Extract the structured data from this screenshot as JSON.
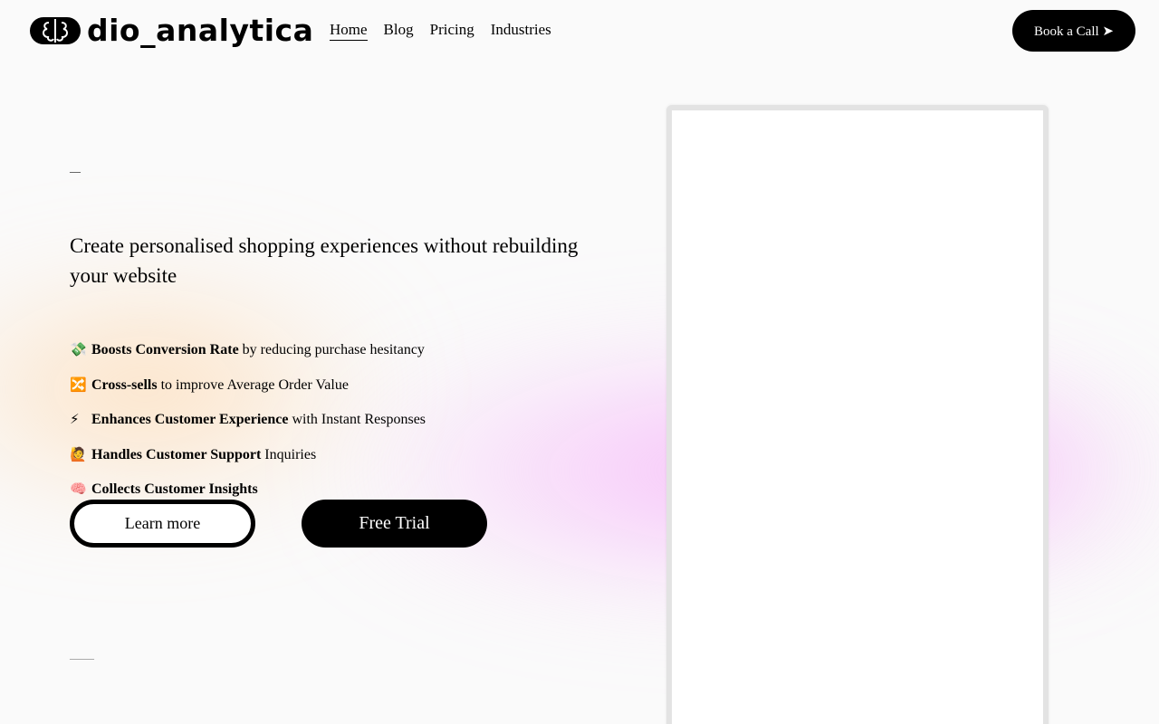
{
  "brand": {
    "name": "dio_analytica"
  },
  "nav": {
    "items": [
      {
        "label": "Home",
        "active": true
      },
      {
        "label": "Blog"
      },
      {
        "label": "Pricing"
      },
      {
        "label": "Industries"
      }
    ]
  },
  "header": {
    "cta_label": "Book a Call ➤"
  },
  "hero": {
    "eyebrow": "—",
    "headline": "Create personalised shopping experiences without rebuilding your website",
    "features": [
      {
        "icon": "💸",
        "bold": "Boosts Conversion Rate",
        "rest": " by reducing purchase hesitancy"
      },
      {
        "icon": "🔀",
        "bold": "Cross-sells",
        "rest": " to improve Average Order Value"
      },
      {
        "icon": "⚡",
        "bold": "Enhances Customer Experience",
        "rest": " with Instant Responses"
      },
      {
        "icon": "🙋",
        "bold": "Handles Customer Support",
        "rest": " Inquiries"
      },
      {
        "icon": "🧠",
        "bold": "Collects Customer Insights",
        "rest": ""
      }
    ],
    "learn_more_label": "Learn more",
    "free_trial_label": "Free Trial",
    "footer_dash": "———"
  },
  "colors": {
    "accent": "#000000",
    "background": "#fafafa",
    "glow_pink": "#f6aafa",
    "glow_peach": "#ffd2a0"
  }
}
